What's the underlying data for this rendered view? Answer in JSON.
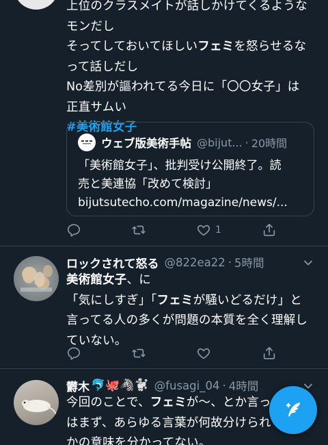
{
  "tweet1": {
    "lines": [
      "上位のクラスメイトが話しかけてくるような",
      "モンだし",
      "そってしておいてほしい",
      "フェミ",
      "を怒らせるな",
      "って話しだし",
      "No差別が謳われてる今日に「〇〇女子」は",
      "正直サムい"
    ],
    "hashtag": "#美術館女子",
    "quote": {
      "name": "ウェブ版美術手帖",
      "handle": "@bijut...",
      "sep": "·",
      "time": "20時間",
      "text_lines": [
        "「美術館女子」、批判受け公開終了。読",
        "売と美連協「改めて検討」",
        "bijutsutecho.com/magazine/news/..."
      ]
    },
    "actions": {
      "reply_count": "",
      "retweet_count": "",
      "like_count": "1",
      "share_count": ""
    }
  },
  "tweet2": {
    "name": "ロックされて怒る",
    "handle": "@822ea22",
    "sep": "·",
    "time": "5時間",
    "lines": [
      "美術館女子",
      "、に",
      "「気にしすぎ」「",
      "フェミ",
      "が騒いどるだけ」と",
      "言ってる人の多くが問題の本質を全く理解し",
      "ていない。"
    ],
    "actions": {
      "reply_count": "",
      "retweet_count": "",
      "like_count": "",
      "share_count": ""
    }
  },
  "tweet3": {
    "name": "欝木",
    "emojis": "🐬🐙🦓🐩",
    "handle": "@fusagi_04",
    "sep": "·",
    "time": "4時間",
    "lines": [
      "今回のことで、",
      "フェミ",
      "が〜、とか言っ",
      "はまず、あらゆる言葉が何故分けられ",
      "かの意味を分かってない。"
    ]
  },
  "icons": {
    "reply": "reply-icon",
    "retweet": "retweet-icon",
    "like": "heart-icon",
    "share": "share-icon",
    "caret": "chevron-down-icon",
    "compose": "compose-tweet-icon"
  },
  "colors": {
    "background": "#15202b",
    "divider": "#38444d",
    "secondary_text": "#8899a6",
    "accent": "#1da1f2"
  }
}
